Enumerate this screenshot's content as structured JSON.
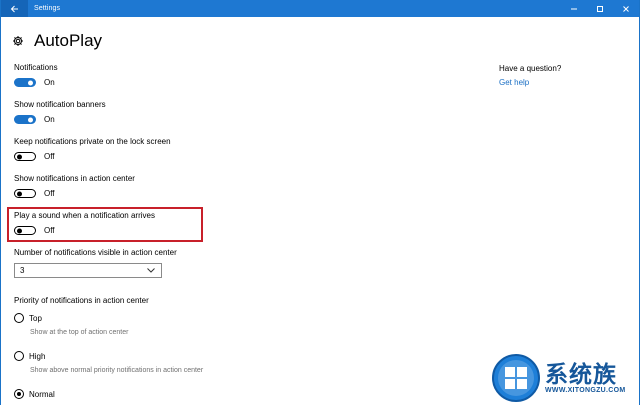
{
  "window": {
    "title": "Settings",
    "accent_color": "#1e78d2",
    "controls": [
      "minimize",
      "maximize",
      "close"
    ]
  },
  "header": {
    "icon": "gear-icon",
    "title": "AutoPlay"
  },
  "settings": [
    {
      "label": "Notifications",
      "on": true,
      "state": "On"
    },
    {
      "label": "Show notification banners",
      "on": true,
      "state": "On"
    },
    {
      "label": "Keep notifications private on the lock screen",
      "on": false,
      "state": "Off"
    },
    {
      "label": "Show notifications in action center",
      "on": false,
      "state": "Off"
    },
    {
      "label": "Play a sound when a notification arrives",
      "on": false,
      "state": "Off",
      "highlighted": true
    }
  ],
  "highlight_color": "#c8202a",
  "visible_count": {
    "label": "Number of notifications visible in action center",
    "value": "3"
  },
  "priority": {
    "label": "Priority of notifications in action center",
    "options": [
      {
        "label": "Top",
        "description": "Show at the top of action center",
        "checked": false
      },
      {
        "label": "High",
        "description": "Show above normal priority notifications in action center",
        "checked": false
      },
      {
        "label": "Normal",
        "checked": true
      }
    ]
  },
  "help": {
    "title": "Have a question?",
    "link": "Get help"
  },
  "watermark": {
    "text": "系统族",
    "url": "WWW.XITONGZU.COM"
  }
}
